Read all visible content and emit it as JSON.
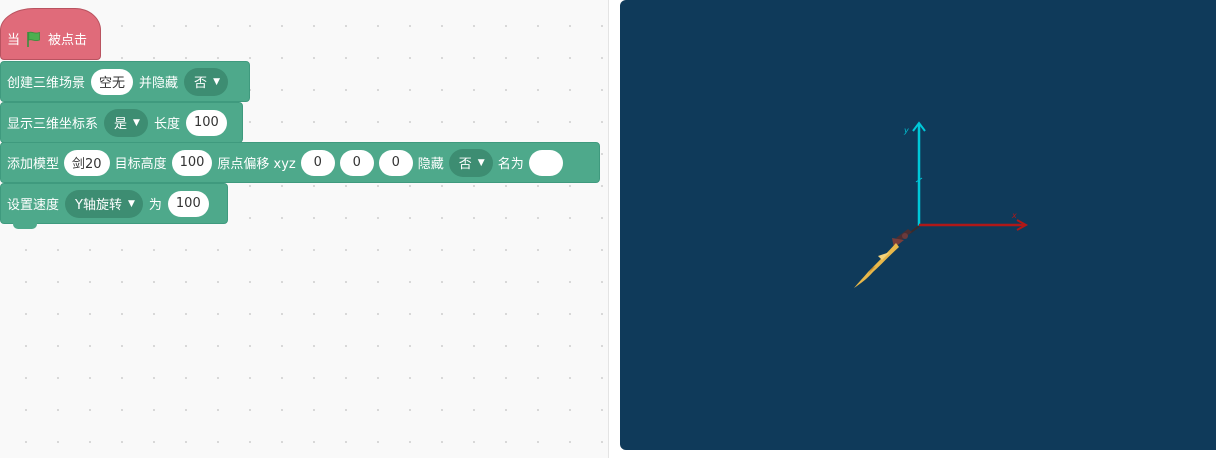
{
  "hat_block": {
    "prefix": "当",
    "suffix": "被点击",
    "flag_color": "#4caf50"
  },
  "blocks": [
    {
      "label1": "创建三维场景",
      "scene_value": "空无",
      "label2": "并隐藏",
      "hide_dropdown": "否"
    },
    {
      "label1": "显示三维坐标系",
      "show_dropdown": "是",
      "label2": "长度",
      "length_value": "100"
    },
    {
      "label1": "添加模型",
      "model_value": "剑20",
      "label2": "目标高度",
      "height_value": "100",
      "label3": "原点偏移 xyz",
      "x_value": "0",
      "y_value": "0",
      "z_value": "0",
      "label4": "隐藏",
      "hide_dropdown": "否",
      "label5": "名为",
      "name_value": ""
    },
    {
      "label1": "设置速度",
      "axis_dropdown": "Y轴旋转",
      "label2": "为",
      "speed_value": "100"
    }
  ],
  "stage": {
    "background": "#0f3a5a",
    "axis_y_color": "#00c8d8",
    "axis_x_color": "#b01818",
    "axis_y_label": "y",
    "axis_x_label": "x"
  },
  "colors": {
    "event_block": "#e06b7a",
    "block": "#4ea98b",
    "dropdown": "#3d8d72"
  }
}
